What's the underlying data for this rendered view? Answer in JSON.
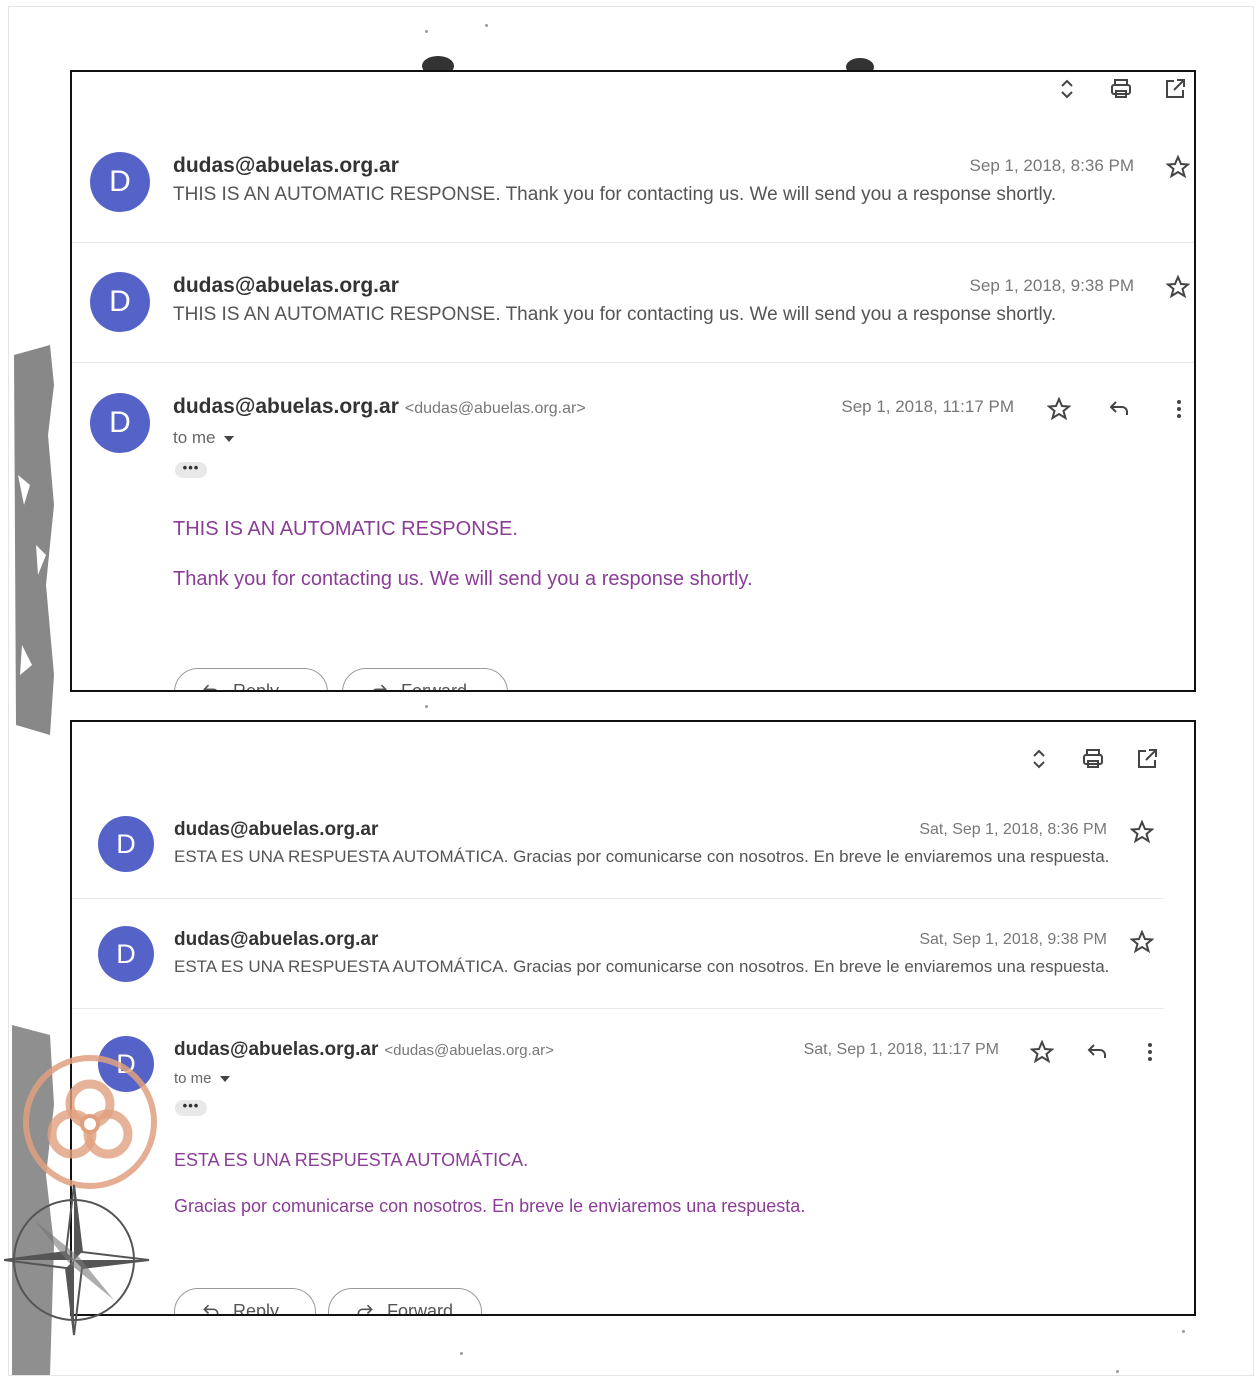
{
  "toolbar_icons": [
    "expand-collapse-icon",
    "print-icon",
    "open-in-new-window-icon"
  ],
  "screenshot_en": {
    "messages": [
      {
        "avatar_letter": "D",
        "sender": "dudas@abuelas.org.ar",
        "snippet": "THIS IS AN AUTOMATIC RESPONSE. Thank you for contacting us. We will send you a response shortly.",
        "date": "Sep 1, 2018, 8:36 PM"
      },
      {
        "avatar_letter": "D",
        "sender": "dudas@abuelas.org.ar",
        "snippet": "THIS IS AN AUTOMATIC RESPONSE. Thank you for contacting us. We will send you a response shortly.",
        "date": "Sep 1, 2018, 9:38 PM"
      }
    ],
    "open_message": {
      "avatar_letter": "D",
      "sender": "dudas@abuelas.org.ar",
      "sender_email": "<dudas@abuelas.org.ar>",
      "date": "Sep 1, 2018, 11:17 PM",
      "to_me": "to me",
      "ellipsis": "•••",
      "body_line1": "THIS IS AN AUTOMATIC RESPONSE.",
      "body_line2": "Thank you for contacting us. We will send you a response shortly.",
      "reply_label": "Reply",
      "forward_label": "Forward"
    }
  },
  "screenshot_es": {
    "messages": [
      {
        "avatar_letter": "D",
        "sender": "dudas@abuelas.org.ar",
        "snippet": "ESTA ES UNA RESPUESTA AUTOMÁTICA. Gracias por comunicarse con nosotros. En breve le enviaremos una respuesta.",
        "date": "Sat, Sep 1, 2018, 8:36 PM"
      },
      {
        "avatar_letter": "D",
        "sender": "dudas@abuelas.org.ar",
        "snippet": "ESTA ES UNA RESPUESTA AUTOMÁTICA. Gracias por comunicarse con nosotros. En breve le enviaremos una respuesta.",
        "date": "Sat, Sep 1, 2018, 9:38 PM"
      }
    ],
    "open_message": {
      "avatar_letter": "D",
      "sender": "dudas@abuelas.org.ar",
      "sender_email": "<dudas@abuelas.org.ar>",
      "date": "Sat, Sep 1, 2018, 11:17 PM",
      "to_me": "to me",
      "ellipsis": "•••",
      "body_line1": "ESTA ES UNA RESPUESTA AUTOMÁTICA.",
      "body_line2": "Gracias por comunicarse con nosotros. En breve le enviaremos una respuesta.",
      "reply_label": "Reply",
      "forward_label": "Forward"
    }
  },
  "colors": {
    "avatar": "#5563c8",
    "body_text": "#8a3d97",
    "frame": "#111111",
    "stamp": "#e0a080"
  }
}
